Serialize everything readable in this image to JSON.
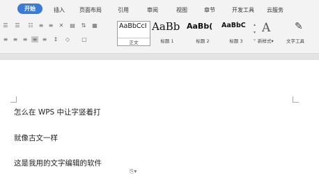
{
  "tabs": [
    {
      "label": "开始",
      "active": true
    },
    {
      "label": "插入"
    },
    {
      "label": "页面布局"
    },
    {
      "label": "引用"
    },
    {
      "label": "审阅"
    },
    {
      "label": "视图"
    },
    {
      "label": "章节"
    },
    {
      "label": "开发工具"
    },
    {
      "label": "云服务"
    }
  ],
  "style_gallery": [
    {
      "sample": "AaBbCcI",
      "label": "正文",
      "selected": true
    },
    {
      "sample": "AaBb",
      "label": "标题 1"
    },
    {
      "sample": "AaBb(",
      "label": "标题 2"
    },
    {
      "sample": "AaBbC",
      "label": "标题 3"
    }
  ],
  "new_style": {
    "label": "新样式",
    "glyph": "A"
  },
  "text_tools": {
    "label": "文字工具"
  },
  "document": {
    "lines": [
      "怎么在 WPS 中让字竖着打",
      "就像古文一样",
      "这是我用的文字编辑的软件"
    ]
  },
  "colors": {
    "accent": "#3a7bd5"
  },
  "icons": {
    "paste_options": "paste-options-icon"
  }
}
